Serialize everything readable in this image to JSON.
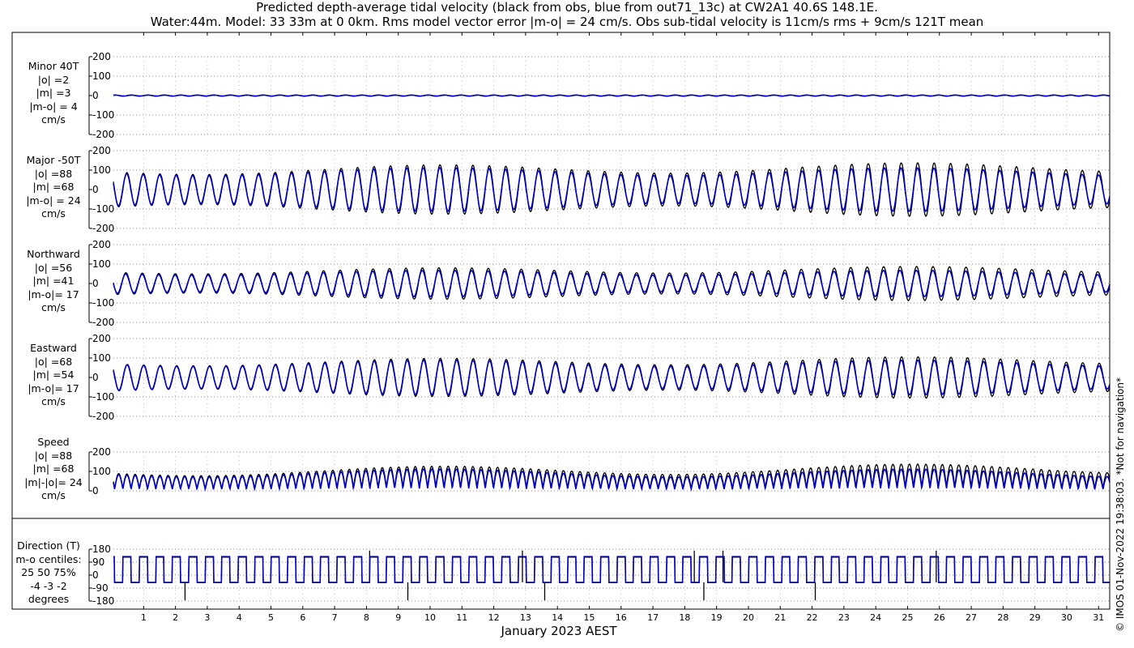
{
  "title": {
    "line1": "Predicted depth-average tidal velocity (black from obs, blue from out71_13c) at CW2A1 40.6S 148.1E.",
    "line2": "Water:44m. Model: 33 33m at 0 0km. Rms model vector error |m-o| = 24 cm/s. Obs sub-tidal velocity is 11cm/s rms + 9cm/s 121T mean"
  },
  "copyright": "© IMOS 01-Nov-2022 19:38:03. *Not for navigation*",
  "colors": {
    "obs": "#000000",
    "model": "#0000cc",
    "grid": "#666666"
  },
  "chart_data": {
    "type": "line",
    "x_axis": {
      "label": "January 2023 AEST",
      "ticks": [
        "1",
        "2",
        "3",
        "4",
        "5",
        "6",
        "7",
        "8",
        "9",
        "10",
        "11",
        "12",
        "13",
        "14",
        "15",
        "16",
        "17",
        "18",
        "19",
        "20",
        "21",
        "22",
        "23",
        "24",
        "25",
        "26",
        "27",
        "28",
        "29",
        "30",
        "31"
      ],
      "xlim_days": [
        0.05,
        31.35
      ]
    },
    "series_legend": [
      {
        "name": "obs",
        "color": "black"
      },
      {
        "name": "out71_13c",
        "color": "blue"
      }
    ],
    "panels": [
      {
        "key": "minor",
        "label": [
          "Minor 40T",
          "|o| =2",
          "|m| =3",
          "|m-o| = 4",
          "cm/s"
        ],
        "ylim": [
          -200,
          200
        ],
        "yticks": [
          "200",
          "100",
          "0",
          "-100",
          "-200"
        ],
        "obs_amp": 2,
        "model_amp": 3,
        "kind": "velocity"
      },
      {
        "key": "major",
        "label": [
          "Major -50T",
          "|o| =88",
          "|m| =68",
          "|m-o| = 24",
          "cm/s"
        ],
        "ylim": [
          -200,
          200
        ],
        "yticks": [
          "200",
          "100",
          "0",
          "-100",
          "-200"
        ],
        "obs_amp": 88,
        "model_amp": 68,
        "kind": "velocity"
      },
      {
        "key": "north",
        "label": [
          "Northward",
          "|o| =56",
          "|m| =41",
          "|m-o|= 17",
          "cm/s"
        ],
        "ylim": [
          -200,
          200
        ],
        "yticks": [
          "200",
          "100",
          "0",
          "-100",
          "-200"
        ],
        "obs_amp": 56,
        "model_amp": 41,
        "kind": "velocity"
      },
      {
        "key": "east",
        "label": [
          "Eastward",
          "|o| =68",
          "|m| =54",
          "|m-o|= 17",
          "cm/s"
        ],
        "ylim": [
          -200,
          200
        ],
        "yticks": [
          "200",
          "100",
          "0",
          "-100",
          "-200"
        ],
        "obs_amp": 68,
        "model_amp": 54,
        "kind": "velocity"
      },
      {
        "key": "speed",
        "label": [
          "Speed",
          "|o| =88",
          "|m| =68",
          "|m|-|o|= 24",
          "cm/s"
        ],
        "ylim": [
          0,
          200
        ],
        "yticks": [
          "200",
          "100",
          "0"
        ],
        "obs_amp": 88,
        "model_amp": 68,
        "kind": "speed"
      },
      {
        "key": "direction",
        "label": [
          "Direction (T)",
          "m-o centiles:",
          "25  50  75%",
          "-4 -3 -2",
          "degrees"
        ],
        "ylim": [
          -180,
          180
        ],
        "yticks": [
          "180",
          "90",
          "0",
          "-90",
          "-180"
        ],
        "kind": "direction"
      }
    ]
  }
}
